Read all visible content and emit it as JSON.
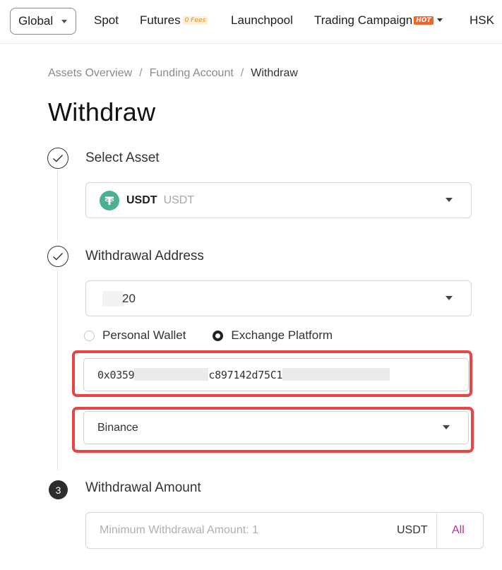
{
  "nav": {
    "region": "Global",
    "spot": "Spot",
    "futures": "Futures",
    "futures_badge": "0 Fees",
    "launchpool": "Launchpool",
    "trading_campaign": "Trading Campaign",
    "trading_campaign_badge": "HOT",
    "hsk": "HSK"
  },
  "breadcrumb": {
    "items": [
      "Assets Overview",
      "Funding Account",
      "Withdraw"
    ],
    "separator": "/"
  },
  "page_title": "Withdraw",
  "steps": {
    "select_asset": {
      "label": "Select Asset",
      "status": "done",
      "asset_symbol": "USDT",
      "asset_name": "USDT"
    },
    "withdrawal_address": {
      "label": "Withdrawal Address",
      "status": "done",
      "network_value_visible": "20",
      "wallet_options": [
        "Personal Wallet",
        "Exchange Platform"
      ],
      "selected_wallet_option": "Exchange Platform",
      "address_start": "0x0359",
      "address_middle": "c897142d75C1",
      "platform": "Binance"
    },
    "withdrawal_amount": {
      "number": "3",
      "label": "Withdrawal Amount",
      "placeholder": "Minimum Withdrawal Amount:  1",
      "unit": "USDT",
      "all_label": "All"
    }
  },
  "colors": {
    "highlight": "#e84545",
    "tether_green": "#4ab293",
    "hot_badge": "#f0652a",
    "all_link": "#b0348a"
  }
}
